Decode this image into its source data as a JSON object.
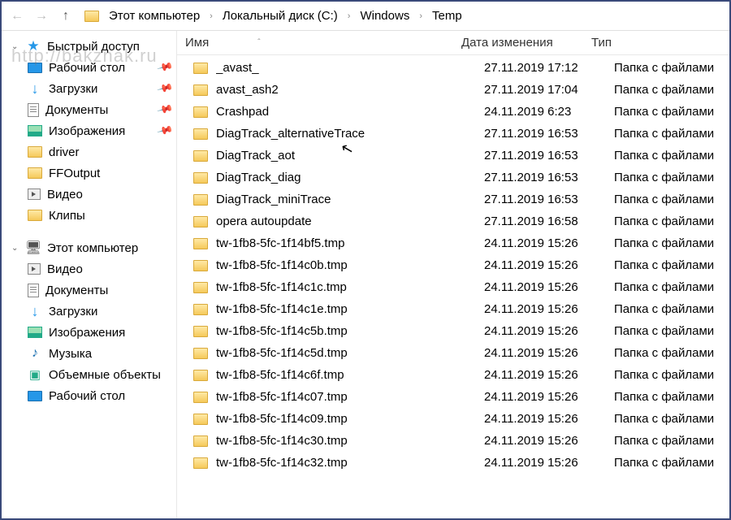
{
  "watermark": "http://bakznak.ru",
  "breadcrumb": [
    "Этот компьютер",
    "Локальный диск (C:)",
    "Windows",
    "Temp"
  ],
  "columns": {
    "name": "Имя",
    "date": "Дата изменения",
    "type": "Тип"
  },
  "sidebar": {
    "quick": {
      "label": "Быстрый доступ",
      "items": [
        {
          "label": "Рабочий стол",
          "icon": "desktop",
          "pinned": true
        },
        {
          "label": "Загрузки",
          "icon": "down",
          "pinned": true
        },
        {
          "label": "Документы",
          "icon": "doc",
          "pinned": true
        },
        {
          "label": "Изображения",
          "icon": "img",
          "pinned": true
        },
        {
          "label": "driver",
          "icon": "folder",
          "pinned": false
        },
        {
          "label": "FFOutput",
          "icon": "folder",
          "pinned": false
        },
        {
          "label": "Видео",
          "icon": "vid",
          "pinned": false
        },
        {
          "label": "Клипы",
          "icon": "folder",
          "pinned": false
        }
      ]
    },
    "pc": {
      "label": "Этот компьютер",
      "items": [
        {
          "label": "Видео",
          "icon": "vid"
        },
        {
          "label": "Документы",
          "icon": "doc"
        },
        {
          "label": "Загрузки",
          "icon": "down"
        },
        {
          "label": "Изображения",
          "icon": "img"
        },
        {
          "label": "Музыка",
          "icon": "music"
        },
        {
          "label": "Объемные объекты",
          "icon": "3d"
        },
        {
          "label": "Рабочий стол",
          "icon": "desktop"
        }
      ]
    }
  },
  "type_folder": "Папка с файлами",
  "files": [
    {
      "name": "_avast_",
      "date": "27.11.2019 17:12"
    },
    {
      "name": "avast_ash2",
      "date": "27.11.2019 17:04"
    },
    {
      "name": "Crashpad",
      "date": "24.11.2019 6:23"
    },
    {
      "name": "DiagTrack_alternativeTrace",
      "date": "27.11.2019 16:53"
    },
    {
      "name": "DiagTrack_aot",
      "date": "27.11.2019 16:53"
    },
    {
      "name": "DiagTrack_diag",
      "date": "27.11.2019 16:53"
    },
    {
      "name": "DiagTrack_miniTrace",
      "date": "27.11.2019 16:53"
    },
    {
      "name": "opera autoupdate",
      "date": "27.11.2019 16:58"
    },
    {
      "name": "tw-1fb8-5fc-1f14bf5.tmp",
      "date": "24.11.2019 15:26"
    },
    {
      "name": "tw-1fb8-5fc-1f14c0b.tmp",
      "date": "24.11.2019 15:26"
    },
    {
      "name": "tw-1fb8-5fc-1f14c1c.tmp",
      "date": "24.11.2019 15:26"
    },
    {
      "name": "tw-1fb8-5fc-1f14c1e.tmp",
      "date": "24.11.2019 15:26"
    },
    {
      "name": "tw-1fb8-5fc-1f14c5b.tmp",
      "date": "24.11.2019 15:26"
    },
    {
      "name": "tw-1fb8-5fc-1f14c5d.tmp",
      "date": "24.11.2019 15:26"
    },
    {
      "name": "tw-1fb8-5fc-1f14c6f.tmp",
      "date": "24.11.2019 15:26"
    },
    {
      "name": "tw-1fb8-5fc-1f14c07.tmp",
      "date": "24.11.2019 15:26"
    },
    {
      "name": "tw-1fb8-5fc-1f14c09.tmp",
      "date": "24.11.2019 15:26"
    },
    {
      "name": "tw-1fb8-5fc-1f14c30.tmp",
      "date": "24.11.2019 15:26"
    },
    {
      "name": "tw-1fb8-5fc-1f14c32.tmp",
      "date": "24.11.2019 15:26"
    }
  ]
}
